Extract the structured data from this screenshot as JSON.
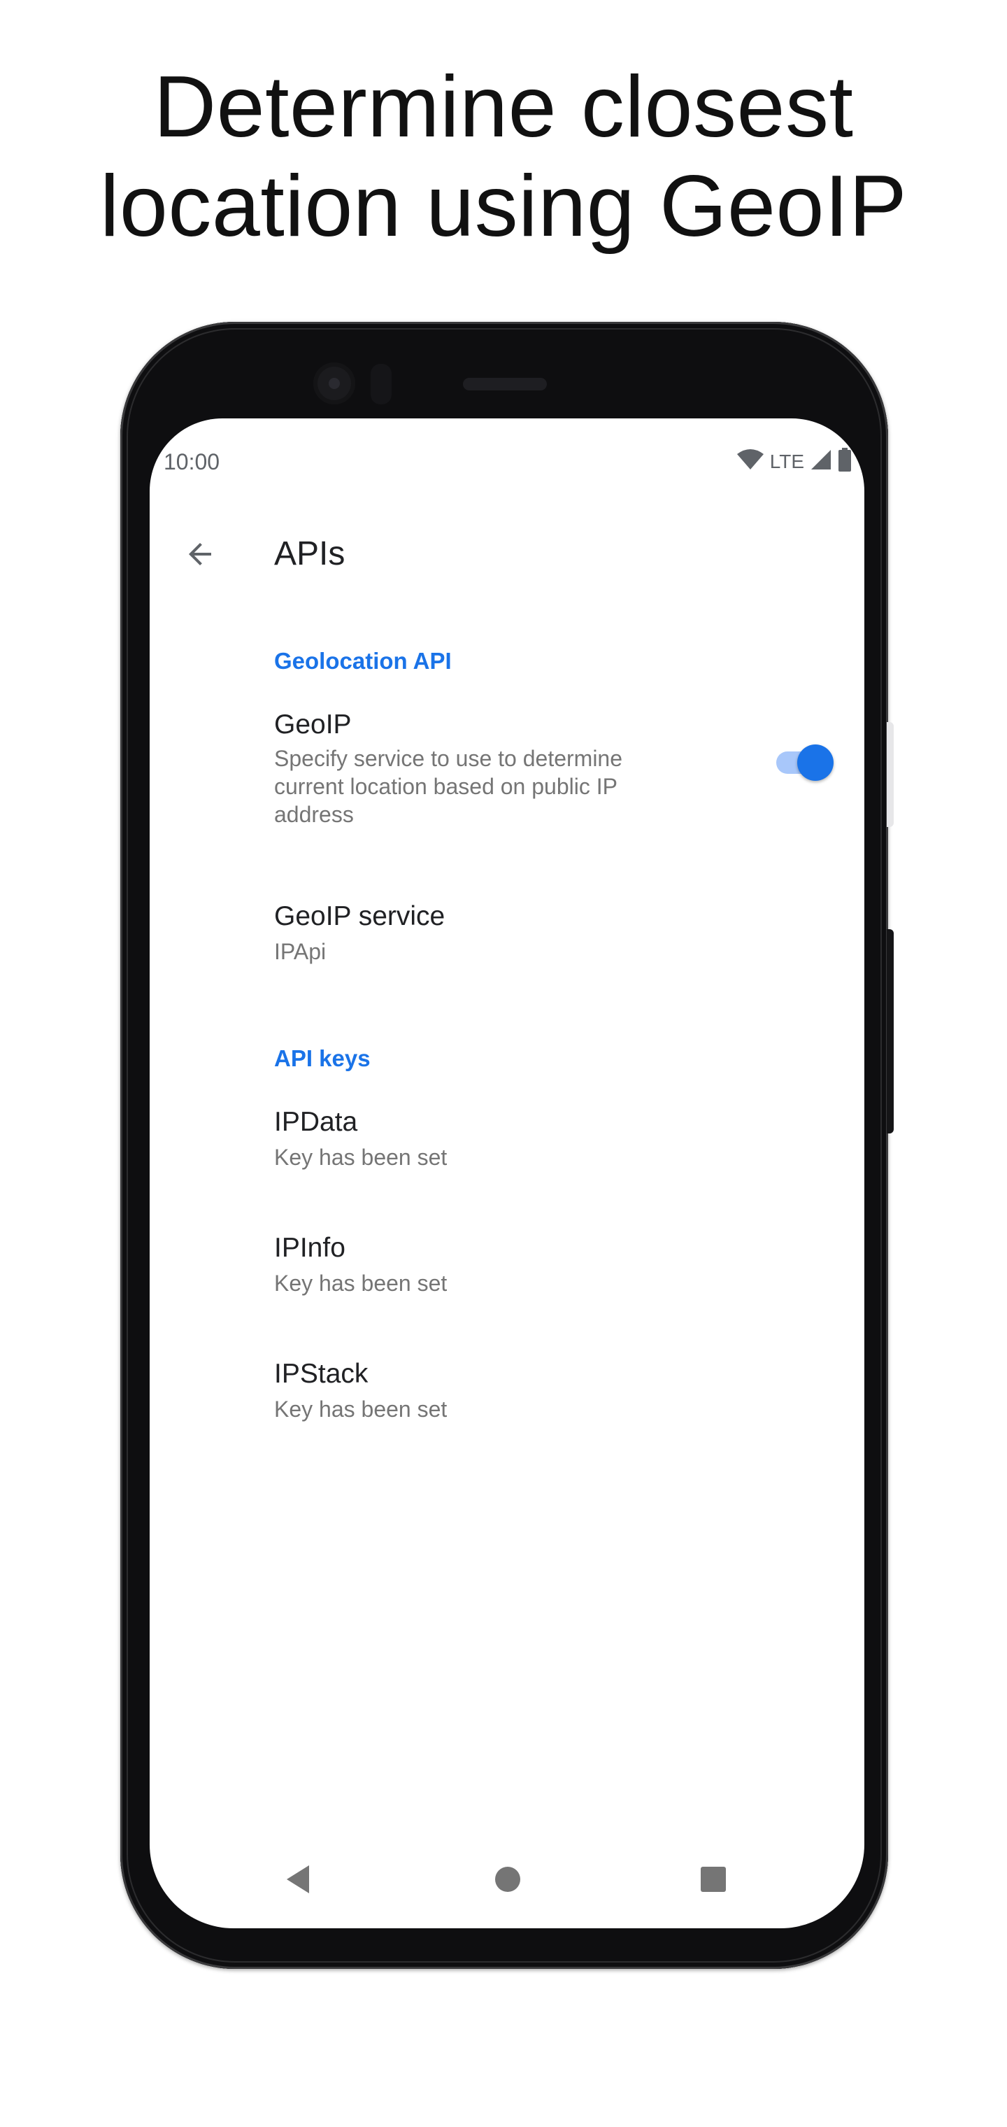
{
  "headline": {
    "line1": "Determine closest",
    "line2": "location using GeoIP"
  },
  "status_bar": {
    "time": "10:00",
    "network": "LTE",
    "icons": [
      "wifi-icon",
      "signal-icon",
      "battery-icon"
    ]
  },
  "app_bar": {
    "back_icon": "arrow-back-icon",
    "title": "APIs"
  },
  "sections": {
    "geolocation": {
      "header": "Geolocation API",
      "geoip": {
        "title": "GeoIP",
        "summary": "Specify service to use to determine current location based on public IP address",
        "enabled": true
      },
      "geoip_service": {
        "title": "GeoIP service",
        "summary": "IPApi"
      }
    },
    "api_keys": {
      "header": "API keys",
      "ipdata": {
        "title": "IPData",
        "summary": "Key has been set"
      },
      "ipinfo": {
        "title": "IPInfo",
        "summary": "Key has been set"
      },
      "ipstack": {
        "title": "IPStack",
        "summary": "Key has been set"
      }
    }
  },
  "nav_bar": {
    "icons": [
      "nav-back-icon",
      "nav-home-icon",
      "nav-recents-icon"
    ]
  },
  "colors": {
    "accent": "#1a73e8",
    "switch_track": "#a8c7fa",
    "text_primary": "#202124",
    "text_secondary": "#757575",
    "phone_body": "#0e0e10"
  }
}
